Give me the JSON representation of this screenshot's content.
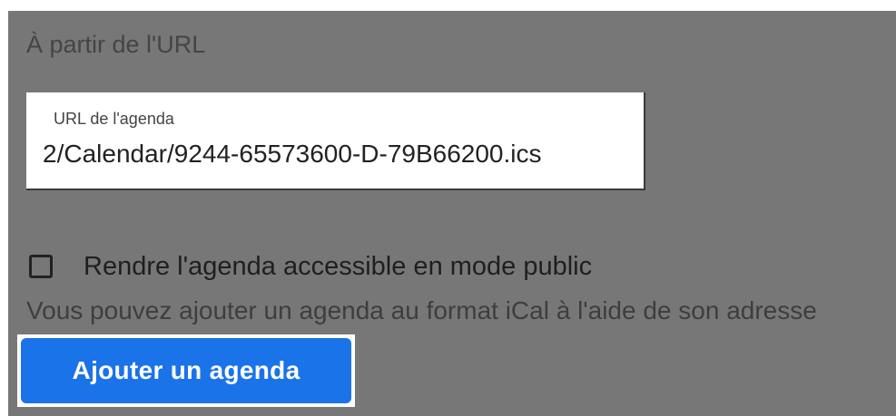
{
  "section": {
    "title": "À partir de l'URL"
  },
  "url_field": {
    "label": "URL de l'agenda",
    "value": "2/Calendar/9244-65573600-D-79B66200.ics"
  },
  "public_option": {
    "label": "Rendre l'agenda accessible en mode public",
    "checked": false
  },
  "help_text": "Vous pouvez ajouter un agenda au format iCal à l'aide de son adresse",
  "add_button": {
    "label": "Ajouter un agenda"
  },
  "colors": {
    "panel_bg": "#777777",
    "button_bg": "#1a73e8",
    "button_text": "#ffffff"
  }
}
